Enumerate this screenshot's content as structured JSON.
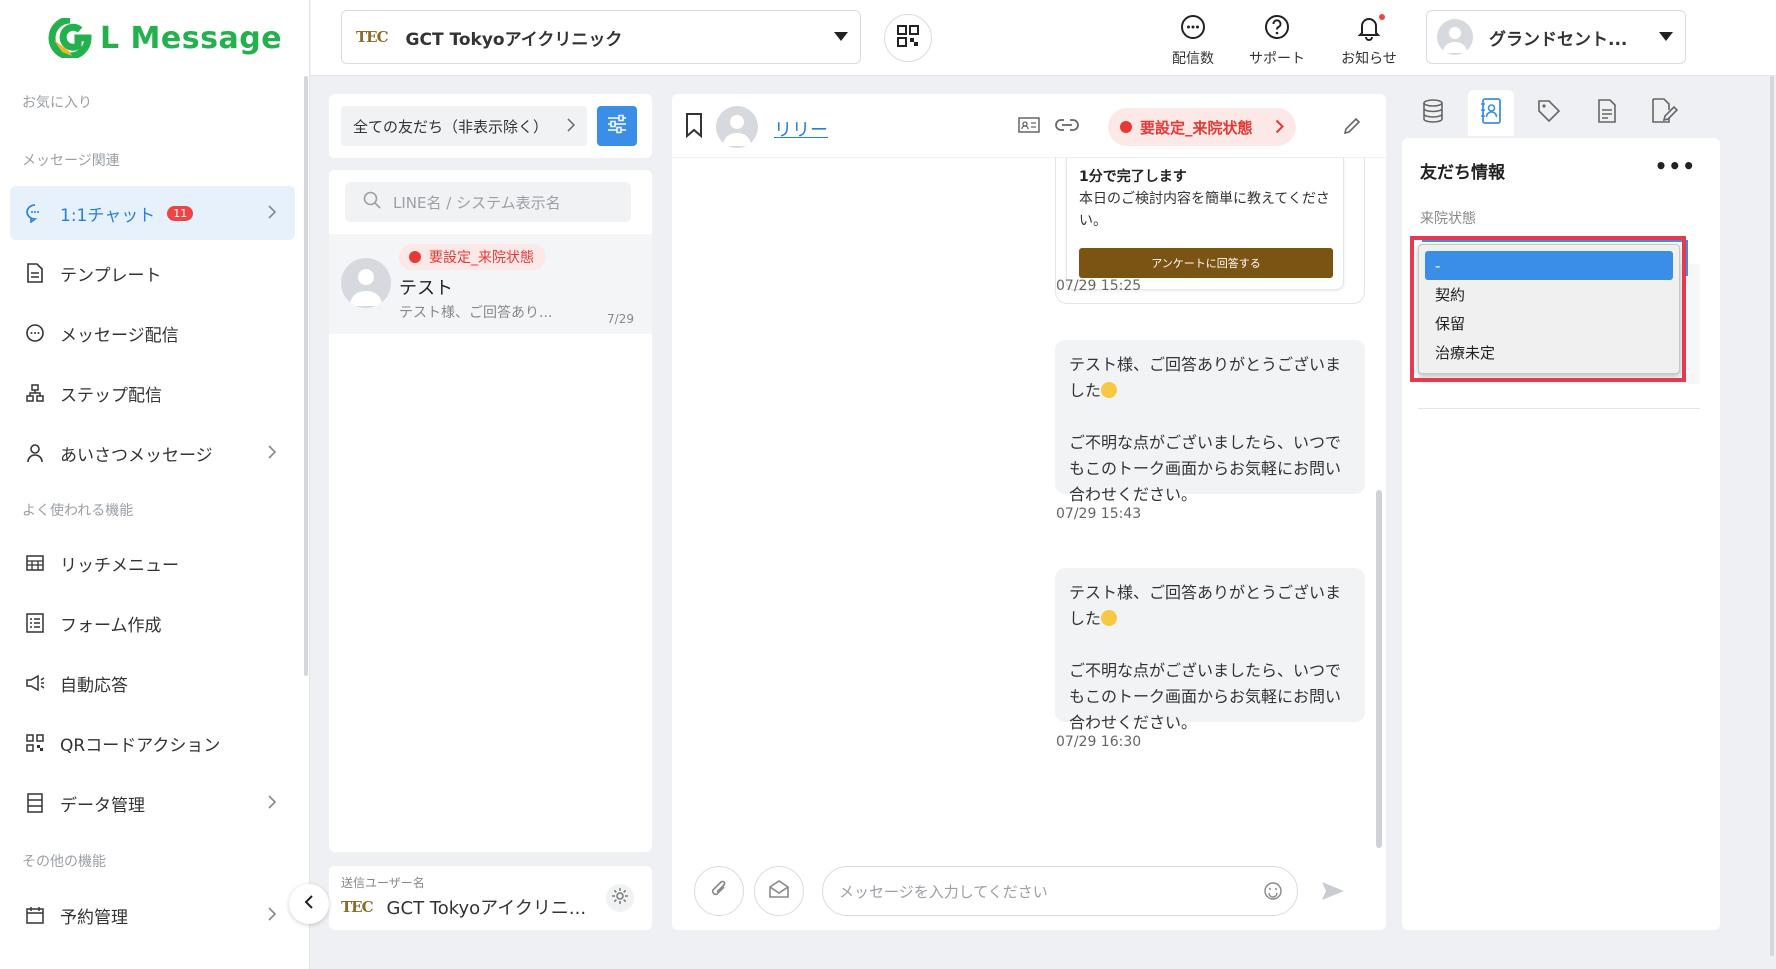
{
  "app": {
    "logo_text": "L Message",
    "brand_color": "#22b14c"
  },
  "sidebar": {
    "sections": {
      "favorites": "お気に入り",
      "message": "メッセージ関連",
      "frequent": "よく使われる機能",
      "other": "その他の機能"
    },
    "items": [
      {
        "label": "1:1チャット",
        "badge": "11",
        "icon": "chat-bubble-icon"
      },
      {
        "label": "テンプレート",
        "icon": "document-icon"
      },
      {
        "label": "メッセージ配信",
        "icon": "message-dots-icon"
      },
      {
        "label": "ステップ配信",
        "icon": "sitemap-icon"
      },
      {
        "label": "あいさつメッセージ",
        "icon": "user-icon"
      },
      {
        "label": "リッチメニュー",
        "icon": "grid-menu-icon"
      },
      {
        "label": "フォーム作成",
        "icon": "form-icon"
      },
      {
        "label": "自動応答",
        "icon": "megaphone-icon"
      },
      {
        "label": "QRコードアクション",
        "icon": "qr-code-icon"
      },
      {
        "label": "データ管理",
        "icon": "database-icon"
      },
      {
        "label": "予約管理",
        "icon": "calendar-icon"
      }
    ]
  },
  "header": {
    "clinic_logo": "TEC",
    "clinic_name": "GCT Tokyoアイクリニック",
    "buttons": {
      "delivery_count": "配信数",
      "support": "サポート",
      "notifications": "お知らせ"
    },
    "user_name": "グランドセント..."
  },
  "friends": {
    "filter_label": "全ての友だち（非表示除く）",
    "search_placeholder": "LINE名 / システム表示名",
    "items": [
      {
        "status": "要設定_来院状態",
        "name": "テスト",
        "preview": "テスト様、ご回答あり...",
        "date": "7/29"
      }
    ],
    "sender_label": "送信ユーザー名",
    "sender_name": "GCT Tokyoアイクリニ..."
  },
  "chat": {
    "friend_name": "リリー",
    "status": "要設定_来院状態",
    "card": {
      "title": "1分で完了します",
      "body": "本日のご検討内容を簡単に教えてください。",
      "button": "アンケートに回答する"
    },
    "times": [
      "07/29 15:25",
      "07/29 15:43",
      "07/29 16:30"
    ],
    "messages": [
      {
        "line1": "テスト様、ご回答ありがとうございました",
        "line2": "ご不明な点がございましたら、いつでもこのトーク画面からお気軽にお問い合わせください。"
      },
      {
        "line1": "テスト様、ご回答ありがとうございました",
        "line2": "ご不明な点がございましたら、いつでもこのトーク画面からお気軽にお問い合わせください。"
      }
    ],
    "input_placeholder": "メッセージを入力してください"
  },
  "info": {
    "title": "友だち情報",
    "more": "•••",
    "field_label": "来院状態",
    "dropdown_options": [
      "-",
      "契約",
      "保留",
      "治療未定"
    ],
    "selected_option": "-"
  },
  "colors": {
    "accent": "#3b8ee8",
    "alert": "#e53935",
    "highlight_box": "#e53950"
  }
}
